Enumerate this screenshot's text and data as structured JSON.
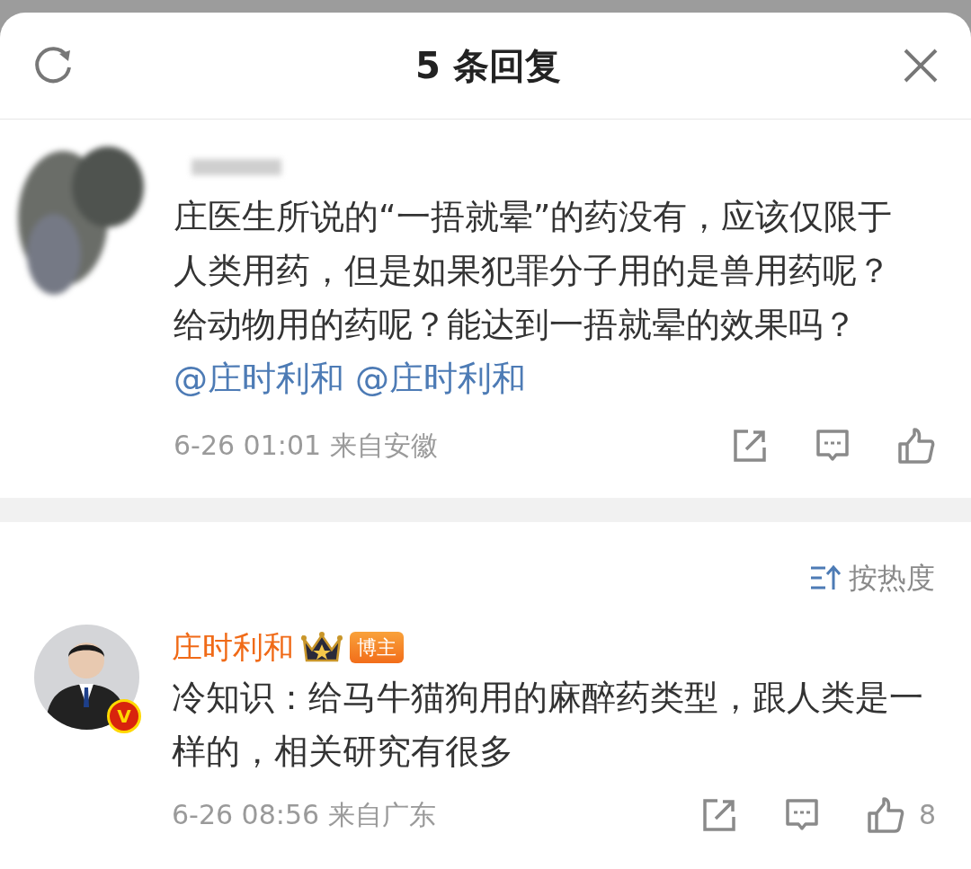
{
  "header": {
    "title": "5 条回复"
  },
  "root_comment": {
    "body": [
      {
        "kind": "text",
        "text": "庄医生所说的“一捂就晕”的药没有，应该仅限于人类用药，但是如果犯罪分子用的是兽用药呢？给动物用的药呢？能达到一捂就晕的效果吗？"
      },
      {
        "kind": "mention",
        "text": "@庄时利和"
      },
      {
        "kind": "mention",
        "text": "@庄时利和"
      }
    ],
    "time": "6-26 01:01",
    "location": "来自安徽"
  },
  "sort": {
    "label": "按热度"
  },
  "replies": [
    {
      "author": "庄时利和",
      "badge": "博主",
      "verified": true,
      "verified_mark": "V",
      "body": "冷知识：给马牛猫狗用的麻醉药类型，跟人类是一样的，相关研究有很多",
      "time": "6-26 08:56",
      "location": "来自广东",
      "likes": "8"
    }
  ]
}
